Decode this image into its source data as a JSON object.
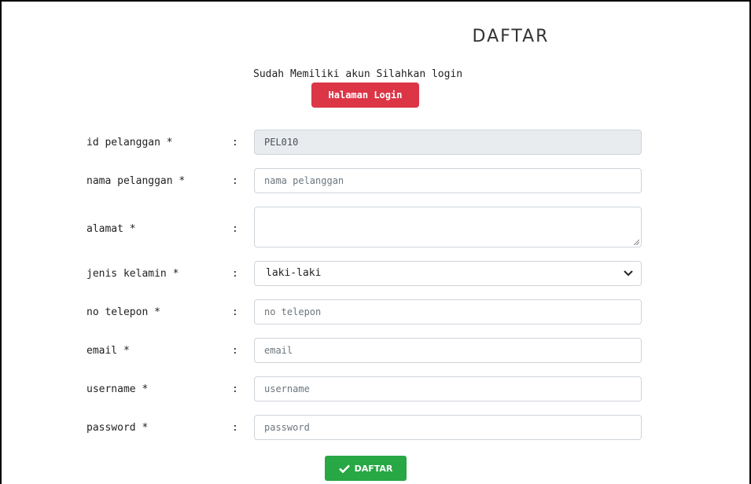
{
  "page": {
    "title": "DAFTAR",
    "login_note": "Sudah Memiliki akun Silahkan login",
    "login_button": "Halaman Login",
    "submit_button": "DAFTAR"
  },
  "form": {
    "colon": ":",
    "id_pelanggan": {
      "label": "id pelanggan *",
      "value": "PEL010"
    },
    "nama_pelanggan": {
      "label": "nama pelanggan *",
      "placeholder": "nama pelanggan"
    },
    "alamat": {
      "label": "alamat *",
      "placeholder": ""
    },
    "jenis_kelamin": {
      "label": "jenis kelamin *",
      "selected": "laki-laki"
    },
    "no_telepon": {
      "label": "no telepon *",
      "placeholder": "no telepon"
    },
    "email": {
      "label": "email *",
      "placeholder": "email"
    },
    "username": {
      "label": "username *",
      "placeholder": "username"
    },
    "password": {
      "label": "password *",
      "placeholder": "password"
    }
  },
  "colors": {
    "danger": "#dc3545",
    "success": "#28a745",
    "disabled_bg": "#e9ecef",
    "border": "#ced4da"
  },
  "icons": {
    "select_chevron": "chevron-down-icon",
    "submit_icon": "check-icon"
  }
}
